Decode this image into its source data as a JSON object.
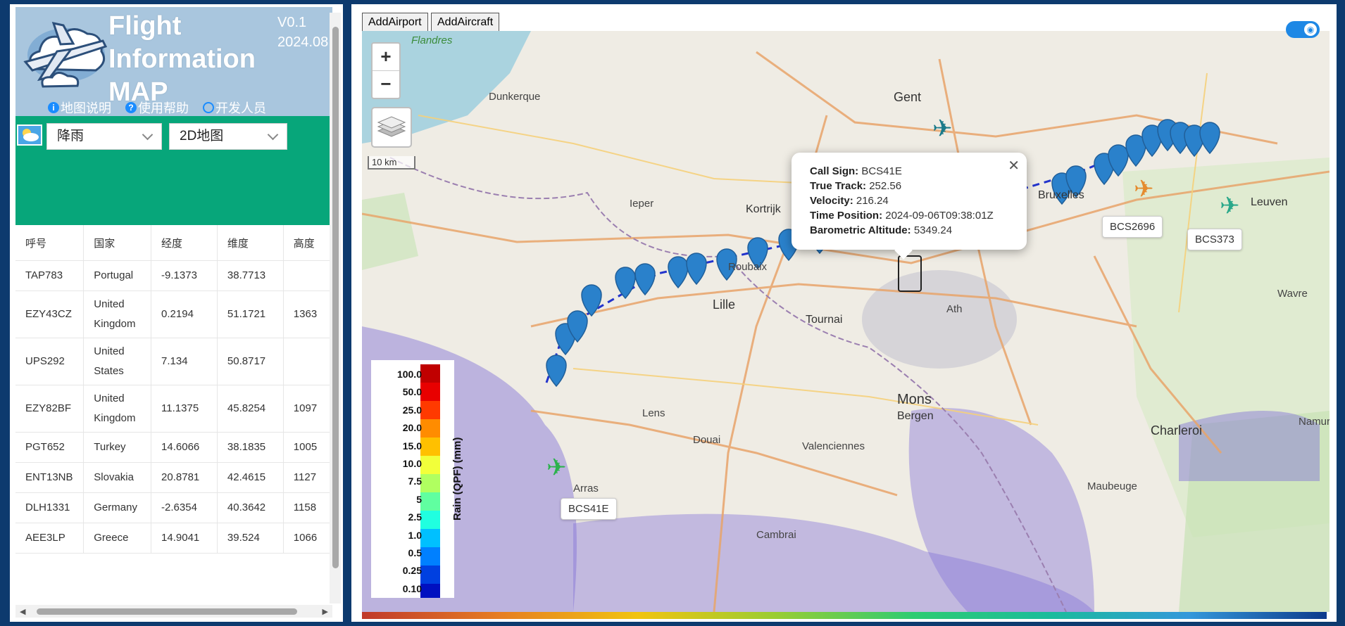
{
  "app": {
    "title_lines": [
      "Flight",
      "Information",
      "MAP"
    ],
    "version": "V0.1",
    "date": "2024.08"
  },
  "links": [
    {
      "label": "地图说明"
    },
    {
      "label": "使用帮助"
    },
    {
      "label": "开发人员"
    }
  ],
  "controls": {
    "weather_select": "降雨",
    "map_type_select": "2D地图"
  },
  "table": {
    "columns": [
      "呼号",
      "国家",
      "经度",
      "维度",
      "高度"
    ],
    "rows": [
      [
        "TAP783",
        "Portugal",
        "-9.1373",
        "38.7713",
        ""
      ],
      [
        "EZY43CZ",
        "United Kingdom",
        "0.2194",
        "51.1721",
        "1363"
      ],
      [
        "UPS292",
        "United States",
        "7.134",
        "50.8717",
        ""
      ],
      [
        "EZY82BF",
        "United Kingdom",
        "11.1375",
        "45.8254",
        "1097"
      ],
      [
        "PGT652",
        "Turkey",
        "14.6066",
        "38.1835",
        "1005"
      ],
      [
        "ENT13NB",
        "Slovakia",
        "20.8781",
        "42.4615",
        "1127"
      ],
      [
        "DLH1331",
        "Germany",
        "-2.6354",
        "40.3642",
        "1158"
      ],
      [
        "AEE3LP",
        "Greece",
        "14.9041",
        "39.524",
        "1066"
      ]
    ]
  },
  "map": {
    "buttons": {
      "add_airport": "AddAirport",
      "add_aircraft": "AddAircraft"
    },
    "zoom_in": "+",
    "zoom_out": "−",
    "scale": "10 km",
    "popup": {
      "call_sign_label": "Call Sign:",
      "call_sign": "BCS41E",
      "true_track_label": "True Track:",
      "true_track": "252.56",
      "velocity_label": "Velocity:",
      "velocity": "216.24",
      "time_label": "Time Position:",
      "time": "2024-09-06T09:38:01Z",
      "alt_label": "Barometric Altitude:",
      "alt": "5349.24"
    },
    "aircraft_tags": [
      "BCS41E",
      "BCS2696",
      "BCS373"
    ],
    "places": [
      "Flandres",
      "Gent",
      "Kortrijk",
      "Lille",
      "Tournai",
      "Mons",
      "Bergen",
      "Charleroi",
      "Bruxelles",
      "Leuven",
      "Douai",
      "Valenciennes",
      "Cambrai",
      "Arras",
      "Lens",
      "Dunkerque",
      "Ieper",
      "Namur",
      "Maubeuge",
      "Wavre",
      "Ath",
      "Roubaix"
    ],
    "legend": {
      "title": "Rain (QPF) (mm)",
      "values": [
        "100.0",
        "50.0",
        "25.0",
        "20.0",
        "15.0",
        "10.0",
        "7.5",
        "5",
        "2.5",
        "1.0",
        "0.5",
        "0.25",
        "0.10"
      ]
    }
  }
}
